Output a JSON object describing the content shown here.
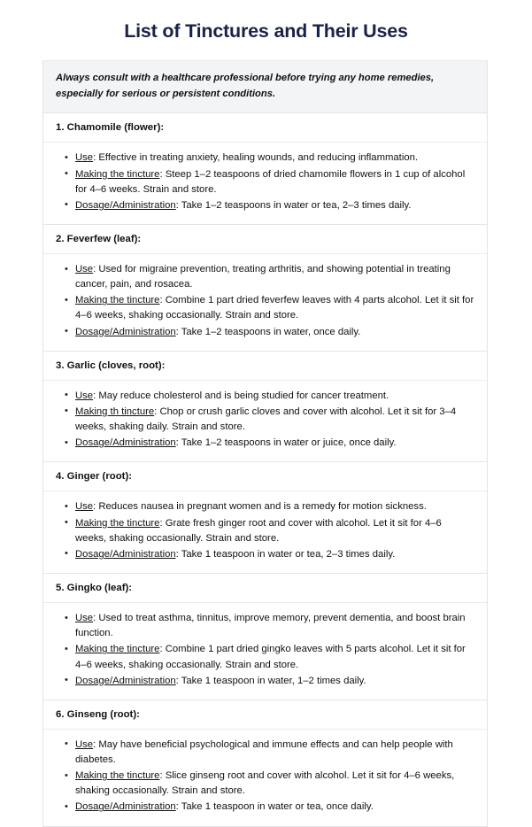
{
  "document": {
    "title": "List of Tinctures and Their Uses",
    "title_color": "#1b2247",
    "disclaimer": "Always consult with a healthcare professional before trying any home remedies, especially for serious or persistent conditions."
  },
  "labels": {
    "use": "Use",
    "making": "Making the tincture",
    "making_typo": "Making th tincture",
    "dosage": "Dosage/Administration"
  },
  "sections": [
    {
      "header": "1. Chamomile (flower):",
      "points": [
        {
          "label": "Use",
          "text": ": Effective in treating anxiety, healing wounds, and reducing inflammation."
        },
        {
          "label": "Making the tincture",
          "text": ": Steep 1–2 teaspoons of dried chamomile flowers in 1 cup of alcohol for 4–6 weeks. Strain and store."
        },
        {
          "label": "Dosage/Administration",
          "text": ": Take 1–2 teaspoons in water or tea, 2–3 times daily."
        }
      ]
    },
    {
      "header": "2. Feverfew (leaf):",
      "points": [
        {
          "label": "Use",
          "text": ": Used for migraine prevention, treating arthritis, and showing potential in treating cancer, pain, and rosacea."
        },
        {
          "label": "Making the tincture",
          "text": ": Combine 1 part dried feverfew leaves with 4 parts alcohol. Let it sit for 4–6 weeks, shaking occasionally. Strain and store."
        },
        {
          "label": "Dosage/Administration",
          "text": ": Take 1–2 teaspoons in water, once daily."
        }
      ]
    },
    {
      "header": "3. Garlic (cloves, root):",
      "points": [
        {
          "label": "Use",
          "text": ": May reduce cholesterol and is being studied for cancer treatment."
        },
        {
          "label": "Making th tincture",
          "text": ": Chop or crush garlic cloves and cover with alcohol. Let it sit for 3–4 weeks, shaking daily. Strain and store."
        },
        {
          "label": "Dosage/Administration",
          "text": ": Take 1–2 teaspoons in water or juice, once daily."
        }
      ]
    },
    {
      "header": "4. Ginger (root):",
      "points": [
        {
          "label": "Use",
          "text": ": Reduces nausea in pregnant women and is a remedy for motion sickness."
        },
        {
          "label": "Making the tincture",
          "text": ": Grate fresh ginger root and cover with alcohol. Let it sit for 4–6 weeks, shaking occasionally. Strain and store."
        },
        {
          "label": "Dosage/Administration",
          "text": ": Take 1 teaspoon in water or tea, 2–3 times daily."
        }
      ]
    },
    {
      "header": "5. Gingko (leaf):",
      "points": [
        {
          "label": "Use",
          "text": ": Used to treat asthma, tinnitus, improve memory, prevent dementia, and boost brain function."
        },
        {
          "label": "Making the tincture",
          "text": ": Combine 1 part dried gingko leaves with 5 parts alcohol. Let it sit for 4–6 weeks, shaking occasionally. Strain and store."
        },
        {
          "label": "Dosage/Administration",
          "text": ": Take 1 teaspoon in water, 1–2 times daily."
        }
      ]
    },
    {
      "header": "6. Ginseng (root):",
      "points": [
        {
          "label": "Use",
          "text": ": May have beneficial psychological and immune effects and can help people with diabetes."
        },
        {
          "label": "Making the tincture",
          "text": ": Slice ginseng root and cover with alcohol. Let it sit for 4–6 weeks, shaking occasionally. Strain and store."
        },
        {
          "label": "Dosage/Administration",
          "text": ": Take 1 teaspoon in water or tea, once daily."
        }
      ]
    }
  ]
}
